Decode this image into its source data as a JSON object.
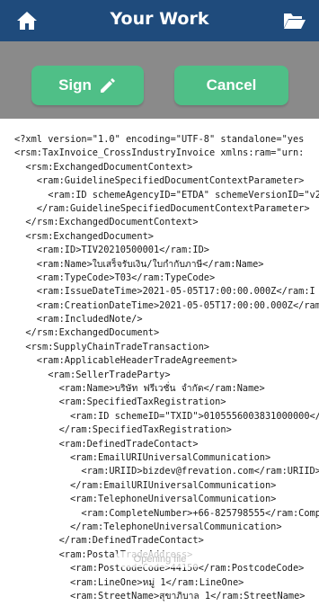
{
  "header": {
    "title": "Your Work",
    "home_icon": "home-icon",
    "folder_icon": "folder-open-icon",
    "background": "#1f4b7c"
  },
  "actions": {
    "sign_label": "Sign",
    "sign_icon": "pencil-icon",
    "cancel_label": "Cancel",
    "button_color": "#4fbf87",
    "bar_color": "#8a8a8a"
  },
  "xml_lines": [
    "<?xml version=\"1.0\" encoding=\"UTF-8\" standalone=\"yes",
    "<rsm:TaxInvoice_CrossIndustryInvoice xmlns:ram=\"urn:",
    "  <rsm:ExchangedDocumentContext>",
    "    <ram:GuidelineSpecifiedDocumentContextParameter>",
    "      <ram:ID schemeAgencyID=\"ETDA\" schemeVersionID=\"v2",
    "    </ram:GuidelineSpecifiedDocumentContextParameter>",
    "  </rsm:ExchangedDocumentContext>",
    "  <rsm:ExchangedDocument>",
    "    <ram:ID>TIV20210500001</ram:ID>",
    "    <ram:Name>ใบเสร็จรับเงิน/ใบกำกับภาษี</ram:Name>",
    "    <ram:TypeCode>T03</ram:TypeCode>",
    "    <ram:IssueDateTime>2021-05-05T17:00:00.000Z</ram:I",
    "    <ram:CreationDateTime>2021-05-05T17:00:00.000Z</ram",
    "    <ram:IncludedNote/>",
    "  </rsm:ExchangedDocument>",
    "  <rsm:SupplyChainTradeTransaction>",
    "    <ram:ApplicableHeaderTradeAgreement>",
    "      <ram:SellerTradeParty>",
    "        <ram:Name>บริษัท ฟรีเวชั่น จำกัด</ram:Name>",
    "        <ram:SpecifiedTaxRegistration>",
    "          <ram:ID schemeID=\"TXID\">0105556003831000000</ram",
    "        </ram:SpecifiedTaxRegistration>",
    "        <ram:DefinedTradeContact>",
    "          <ram:EmailURIUniversalCommunication>",
    "            <ram:URIID>bizdev@frevation.com</ram:URIID>",
    "          </ram:EmailURIUniversalCommunication>",
    "          <ram:TelephoneUniversalCommunication>",
    "            <ram:CompleteNumber>+66-825798555</ram:Complet",
    "          </ram:TelephoneUniversalCommunication>",
    "        </ram:DefinedTradeContact>",
    "        <ram:PostalTradeAddress>",
    "          <ram:PostcodeCode>44150</ram:PostcodeCode>",
    "          <ram:LineOne>หมู่ 1</ram:LineOne>",
    "          <ram:StreetName>สุขาภิบาล 1</ram:StreetName>"
  ],
  "toast": "Opening file"
}
